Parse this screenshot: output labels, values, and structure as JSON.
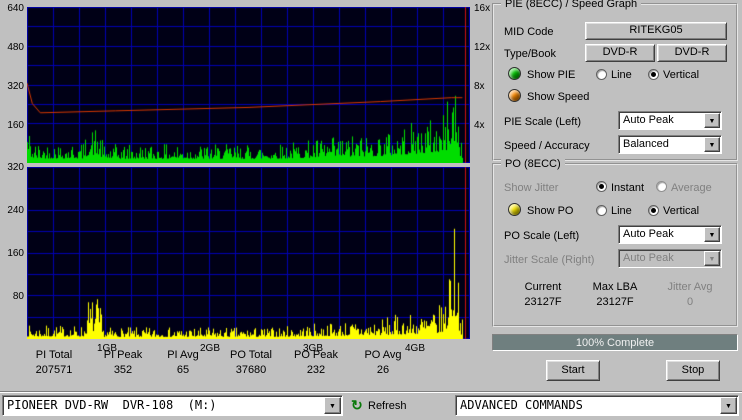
{
  "colors": {
    "window_bg": "#c0c0c0",
    "pie_led": "#00cc00",
    "speed_led": "#ff8c00",
    "po_led": "#ffee00",
    "progress_fill": "#6f7f7f"
  },
  "stats": {
    "items": [
      {
        "label": "PI Total",
        "value": "207571"
      },
      {
        "label": "PI Peak",
        "value": "352"
      },
      {
        "label": "PI Avg",
        "value": "65"
      },
      {
        "label": "PO Total",
        "value": "37680"
      },
      {
        "label": "PO Peak",
        "value": "232"
      },
      {
        "label": "PO Avg",
        "value": "26"
      }
    ]
  },
  "bottom_bar": {
    "drive": "PIONEER DVD-RW  DVR-108  (M:)",
    "refresh": "Refresh",
    "commands": "ADVANCED COMMANDS"
  },
  "pie_panel": {
    "title": "PIE (8ECC) / Speed Graph",
    "mid_label": "MID Code",
    "mid_value": "RITEKG05",
    "type_label": "Type/Book",
    "type_value_1": "DVD-R",
    "type_value_2": "DVD-R",
    "show_pie": "Show PIE",
    "line": "Line",
    "vertical": "Vertical",
    "show_speed": "Show Speed",
    "pie_scale_label": "PIE Scale (Left)",
    "pie_scale_value": "Auto Peak",
    "speed_accuracy_label": "Speed / Accuracy",
    "speed_accuracy_value": "Balanced"
  },
  "po_panel": {
    "title": "PO (8ECC)",
    "show_jitter": "Show Jitter",
    "instant": "Instant",
    "average": "Average",
    "show_po": "Show PO",
    "line": "Line",
    "vertical": "Vertical",
    "po_scale_label": "PO Scale (Left)",
    "po_scale_value": "Auto Peak",
    "jitter_scale_label": "Jitter Scale (Right)",
    "jitter_scale_value": "Auto Peak",
    "current_label": "Current",
    "current_value": "23127F",
    "max_lba_label": "Max LBA",
    "max_lba_value": "23127F",
    "jitter_avg_label": "Jitter Avg",
    "jitter_avg_value": "0"
  },
  "progress": {
    "text": "100% Complete",
    "percent": 100
  },
  "buttons": {
    "start": "Start",
    "stop": "Stop"
  },
  "chart_data": [
    {
      "id": "pie",
      "type": "area",
      "title": "PIE (8ECC) / Speed Graph",
      "bg": "#000016",
      "grid_color": "#0000b4",
      "grid_divx": 17,
      "grid_divy": 8,
      "ylim": [
        0,
        640
      ],
      "y_ticks": [
        "640",
        "480",
        "320",
        "160"
      ],
      "right_ylim": [
        0,
        16
      ],
      "right_ticks": [
        "16x",
        "12x",
        "8x",
        "4x"
      ],
      "x_range_gb": [
        0,
        4.38
      ],
      "series": [
        {
          "name": "PIE",
          "mode": "vertical",
          "color": "#00dd00",
          "seed": 42,
          "noise_floor": 0.22,
          "noise_shape": 2.2,
          "envelope": [
            [
              0,
              180
            ],
            [
              0.012,
              85
            ],
            [
              0.128,
              85
            ],
            [
              0.138,
              150
            ],
            [
              0.162,
              150
            ],
            [
              0.172,
              78
            ],
            [
              0.55,
              78
            ],
            [
              0.8,
              130
            ],
            [
              0.93,
              200
            ],
            [
              0.948,
              240
            ],
            [
              0.956,
              352
            ],
            [
              0.974,
              352
            ],
            [
              0.978,
              130
            ],
            [
              0.985,
              90
            ]
          ],
          "stats": {
            "total": 207571,
            "peak": 352,
            "avg": 65
          }
        },
        {
          "name": "Speed",
          "mode": "line",
          "axis": "right",
          "color": "#d83800",
          "points": [
            [
              0,
              8.2
            ],
            [
              0.012,
              6.1
            ],
            [
              0.03,
              5.15
            ],
            [
              0.2,
              5.35
            ],
            [
              0.5,
              5.7
            ],
            [
              0.8,
              6.3
            ],
            [
              0.96,
              6.7
            ],
            [
              0.985,
              6.7
            ]
          ]
        }
      ],
      "cursor": {
        "x": 0.99,
        "color": "#cc1010"
      }
    },
    {
      "id": "po",
      "type": "area",
      "title": "PO (8ECC)",
      "bg": "#000016",
      "grid_color": "#0000b4",
      "grid_divx": 17,
      "grid_divy": 8,
      "ylim": [
        0,
        320
      ],
      "y_ticks": [
        "320",
        "240",
        "160",
        "80"
      ],
      "x_ticks": [
        "1GB",
        "2GB",
        "3GB",
        "4GB"
      ],
      "x_range_gb": [
        0,
        4.38
      ],
      "series": [
        {
          "name": "PO",
          "mode": "vertical",
          "color": "#ffff00",
          "seed": 7,
          "noise_floor": 0.18,
          "noise_shape": 2.4,
          "envelope": [
            [
              0,
              26
            ],
            [
              0.128,
              26
            ],
            [
              0.138,
              80
            ],
            [
              0.162,
              80
            ],
            [
              0.172,
              22
            ],
            [
              0.55,
              22
            ],
            [
              0.8,
              40
            ],
            [
              0.93,
              60
            ],
            [
              0.948,
              90
            ],
            [
              0.956,
              232
            ],
            [
              0.974,
              232
            ],
            [
              0.978,
              60
            ],
            [
              0.985,
              35
            ]
          ],
          "stats": {
            "total": 37680,
            "peak": 232,
            "avg": 26
          }
        }
      ],
      "cursor": {
        "x": 0.99,
        "color": "#cc1010"
      }
    }
  ]
}
